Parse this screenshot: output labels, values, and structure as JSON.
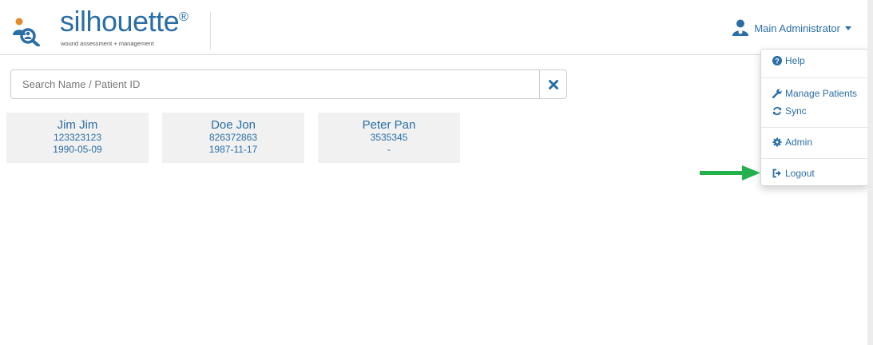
{
  "app": {
    "brand": "silhouette",
    "brand_mark": "®",
    "tagline": "wound assessment + management"
  },
  "header": {
    "user_name": "Main Administrator"
  },
  "search": {
    "placeholder": "Search Name / Patient ID",
    "value": ""
  },
  "patients": [
    {
      "name": "Jim Jim",
      "id": "123323123",
      "dob": "1990-05-09"
    },
    {
      "name": "Doe Jon",
      "id": "826372863",
      "dob": "1987-11-17"
    },
    {
      "name": "Peter Pan",
      "id": "3535345",
      "dob": "-"
    }
  ],
  "menu": {
    "help": "Help",
    "manage_patients": "Manage Patients",
    "sync": "Sync",
    "admin": "Admin",
    "logout": "Logout"
  },
  "colors": {
    "accent": "#2a6ea6",
    "card_bg": "#f1f1f1",
    "arrow": "#22b14c"
  },
  "icons": [
    "logo-icon",
    "user-icon",
    "clear-icon",
    "help-icon",
    "wrench-icon",
    "sync-icon",
    "gear-icon",
    "logout-icon",
    "arrow-icon"
  ]
}
